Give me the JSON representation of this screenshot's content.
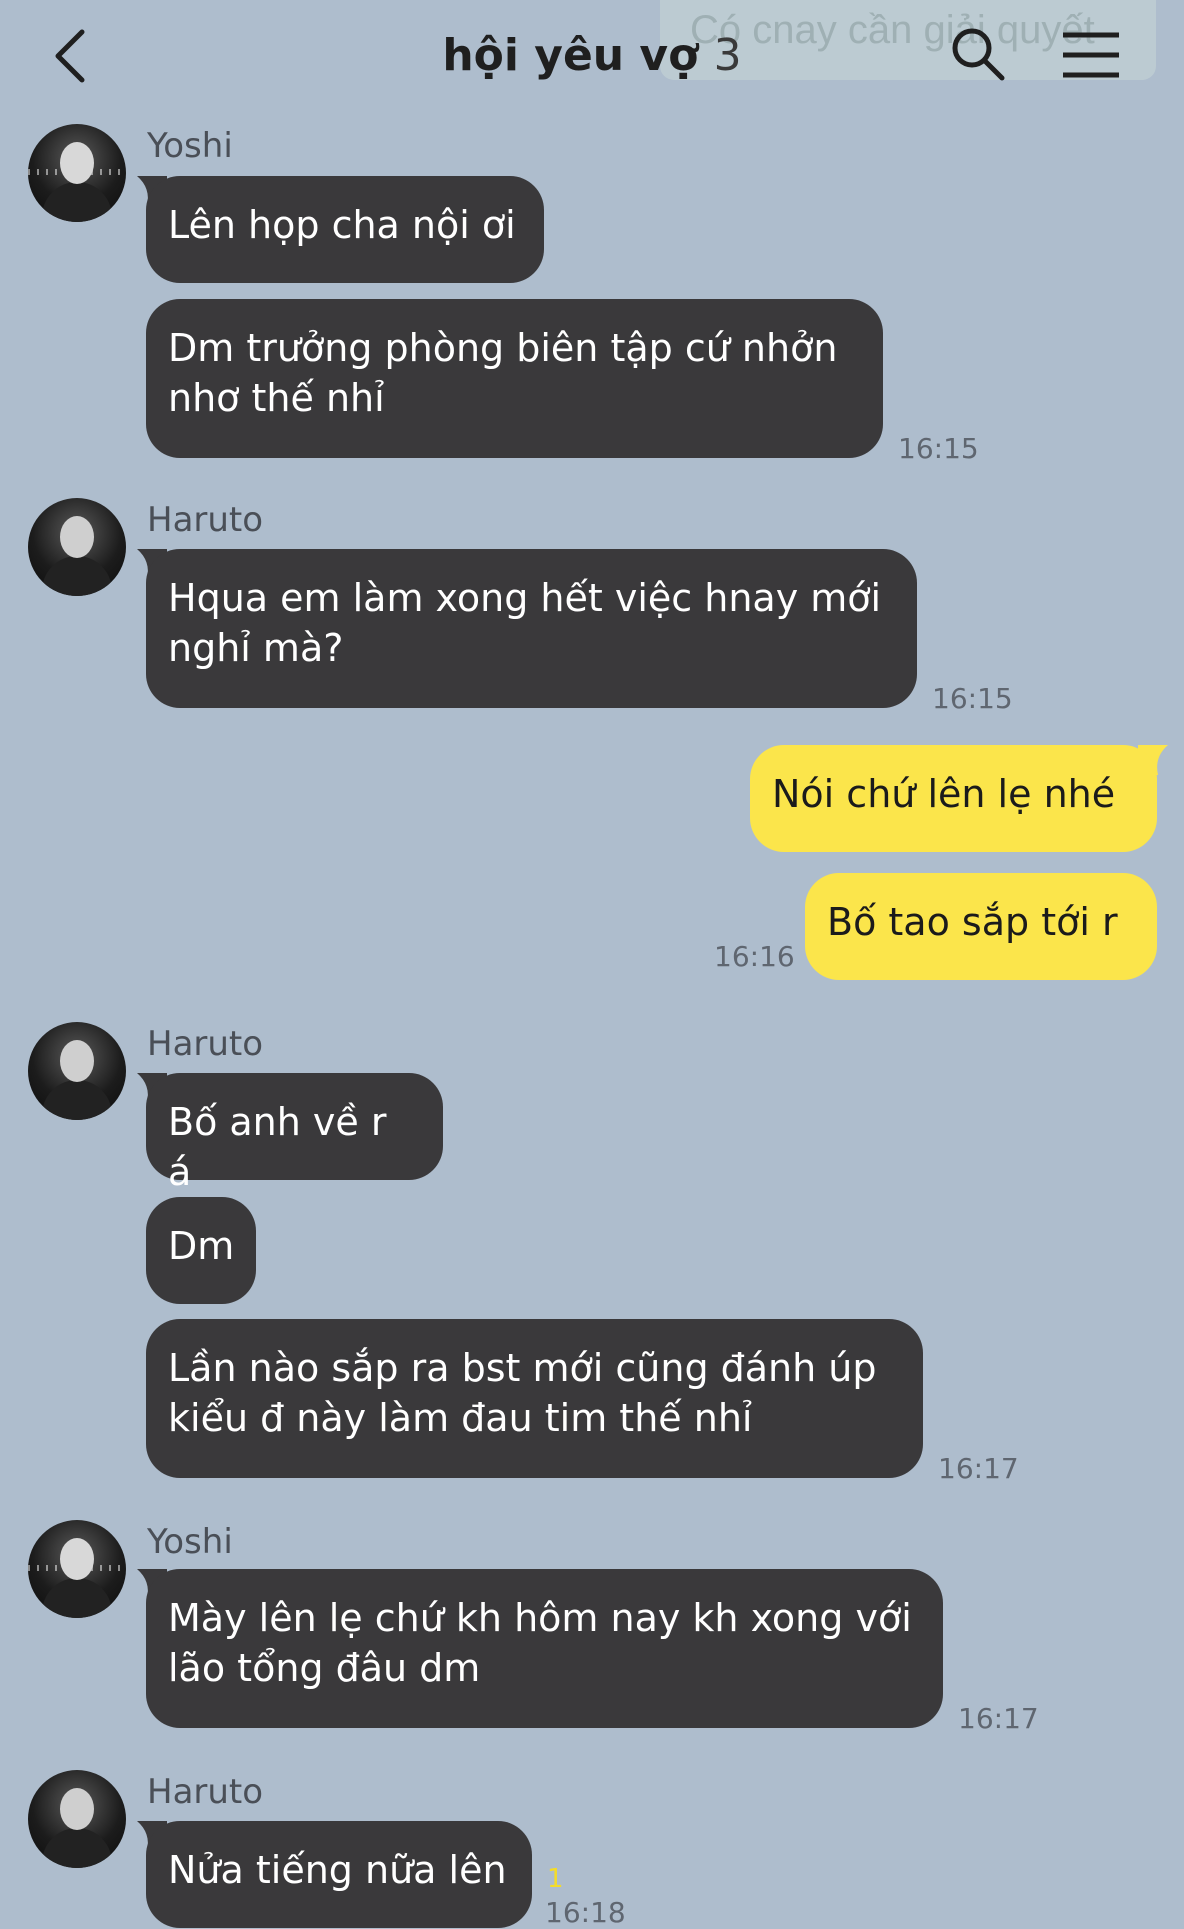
{
  "banner": {
    "text": "Có cnay cần giải quyết"
  },
  "header": {
    "title": "hội yêu vợ",
    "member_count": "3",
    "icons": {
      "back": "chevron-left-icon",
      "search": "search-icon",
      "menu": "menu-icon"
    }
  },
  "colors": {
    "background": "#aebdcd",
    "incoming_bubble": "#3a393b",
    "outgoing_bubble": "#fbe54b",
    "unread": "#f4dc2a"
  },
  "messages": {
    "group1": {
      "sender": "Yoshi",
      "m1": "Lên họp cha nội ơi",
      "m2": "Dm trưởng phòng biên tập cứ nhởn nhơ thế nhỉ",
      "time": "16:15"
    },
    "group2": {
      "sender": "Haruto",
      "m1": "Hqua em làm xong hết việc hnay mới nghỉ mà?",
      "time": "16:15"
    },
    "mine": {
      "m1": "Nói chứ lên lẹ nhé",
      "m2": "Bố tao sắp tới r",
      "time": "16:16"
    },
    "group3": {
      "sender": "Haruto",
      "m1": "Bố anh về r á",
      "m2": "Dm",
      "m3": "Lần nào sắp ra bst mới cũng đánh úp kiểu đ này làm đau tim thế nhỉ",
      "time": "16:17"
    },
    "group4": {
      "sender": "Yoshi",
      "m1": "Mày lên lẹ chứ kh hôm nay kh xong với lão tổng đâu dm",
      "time": "16:17"
    },
    "group5": {
      "sender": "Haruto",
      "m1": "Nửa tiếng nữa lên",
      "unread": "1",
      "time": "16:18"
    }
  }
}
